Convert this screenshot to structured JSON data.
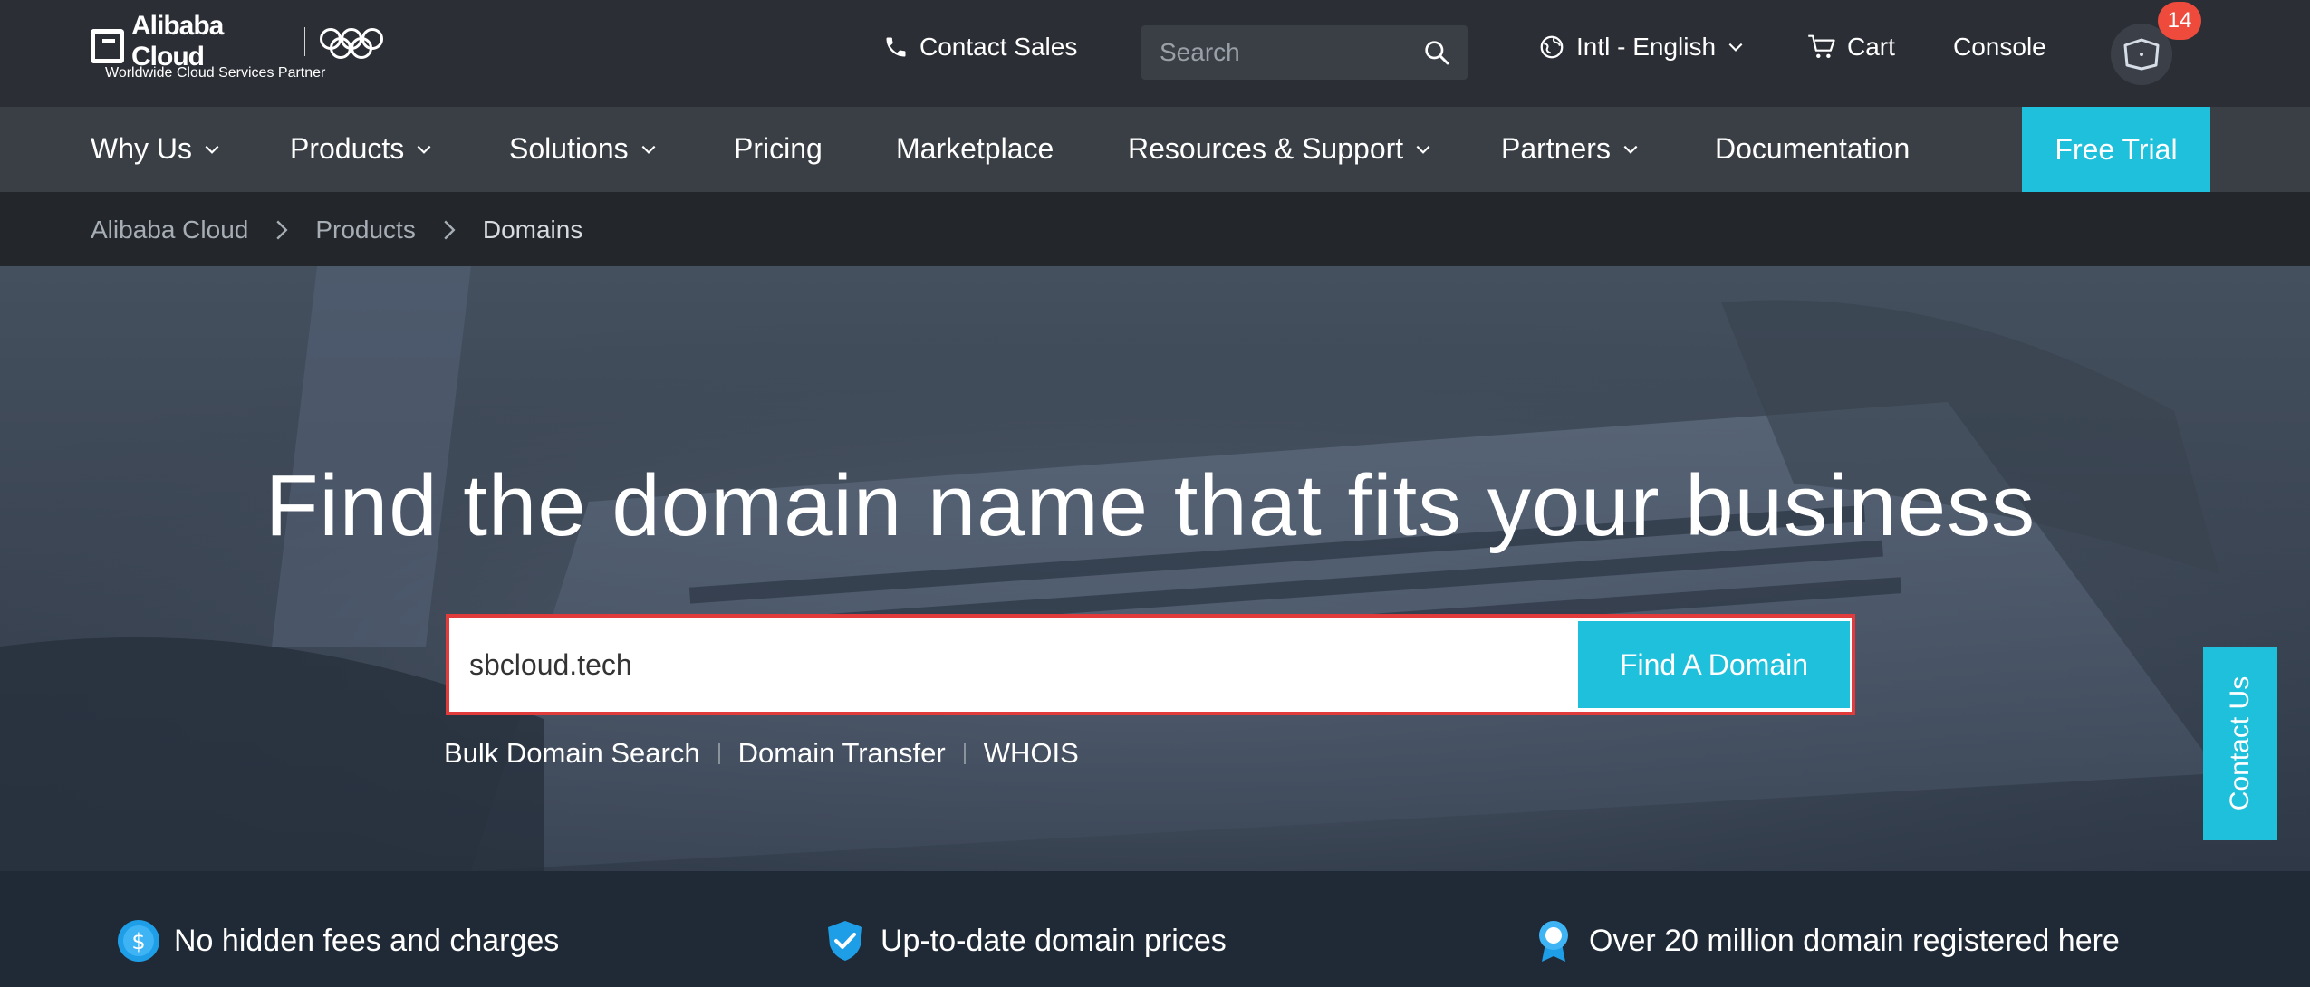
{
  "header": {
    "logo_brand": "Alibaba Cloud",
    "logo_tagline": "Worldwide Cloud Services Partner",
    "contact_sales": "Contact Sales",
    "search_placeholder": "Search",
    "language": "Intl - English",
    "cart": "Cart",
    "console": "Console",
    "notification_count": "14"
  },
  "nav": {
    "items": [
      {
        "label": "Why Us",
        "dropdown": true
      },
      {
        "label": "Products",
        "dropdown": true
      },
      {
        "label": "Solutions",
        "dropdown": true
      },
      {
        "label": "Pricing",
        "dropdown": false
      },
      {
        "label": "Marketplace",
        "dropdown": false
      },
      {
        "label": "Resources & Support",
        "dropdown": true
      },
      {
        "label": "Partners",
        "dropdown": true
      },
      {
        "label": "Documentation",
        "dropdown": false
      }
    ],
    "free_trial": "Free Trial"
  },
  "breadcrumb": [
    "Alibaba Cloud",
    "Products",
    "Domains"
  ],
  "hero": {
    "title": "Find the domain name that fits your business",
    "domain_value": "sbcloud.tech",
    "find_button": "Find A Domain",
    "links": [
      "Bulk Domain Search",
      "Domain Transfer",
      "WHOIS"
    ]
  },
  "contact_us": "Contact Us",
  "features": [
    {
      "icon": "dollar-coin-icon",
      "text": "No hidden fees and charges"
    },
    {
      "icon": "shield-check-icon",
      "text": "Up-to-date domain prices"
    },
    {
      "icon": "award-ribbon-icon",
      "text": "Over 20 million domain registered here"
    }
  ],
  "colors": {
    "accent": "#1fc0dc",
    "badge": "#ef4b3c",
    "topbar": "#2b2f35",
    "navbar": "#3a3f45",
    "highlight_border": "#e23b3b"
  }
}
